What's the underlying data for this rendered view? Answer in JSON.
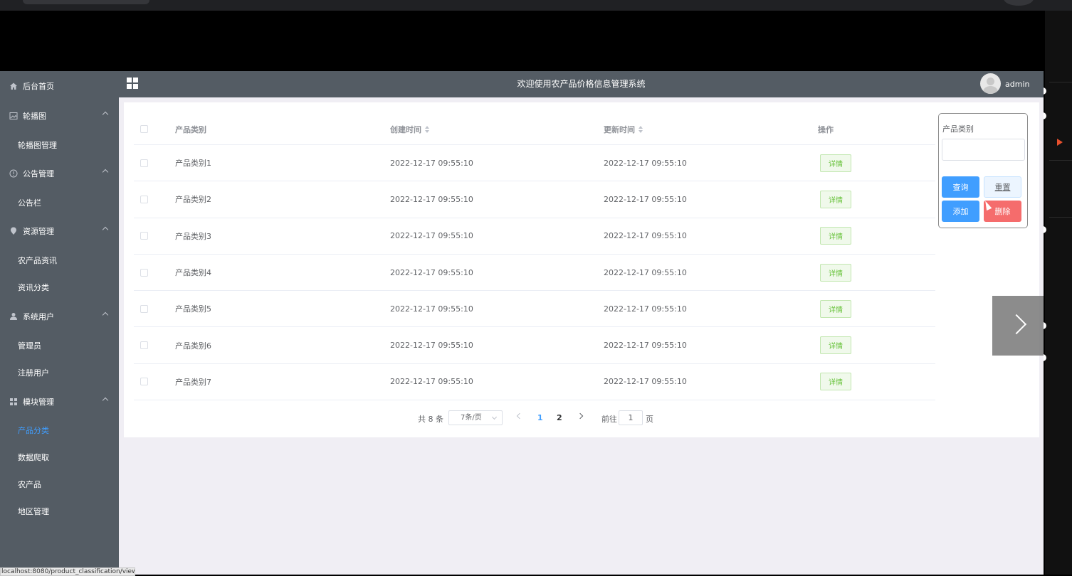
{
  "app": {
    "title": "欢迎使用农产品价格信息管理系统",
    "user": "admin"
  },
  "sidebar": {
    "items": [
      {
        "label": "后台首页",
        "icon": "home-icon"
      },
      {
        "label": "轮播图",
        "icon": "image-icon",
        "children": [
          "轮播图管理"
        ]
      },
      {
        "label": "公告管理",
        "icon": "info-circle-icon",
        "children": [
          "公告栏"
        ]
      },
      {
        "label": "资源管理",
        "icon": "location-icon",
        "children": [
          "农产品资讯",
          "资讯分类"
        ]
      },
      {
        "label": "系统用户",
        "icon": "user-icon",
        "children": [
          "管理员",
          "注册用户"
        ]
      },
      {
        "label": "模块管理",
        "icon": "grid-icon",
        "children": [
          "产品分类",
          "数据爬取",
          "农产品",
          "地区管理"
        ]
      }
    ],
    "active": "产品分类"
  },
  "table": {
    "columns": [
      "产品类别",
      "创建时间",
      "更新时间",
      "操作"
    ],
    "detail_label": "详情",
    "rows": [
      {
        "category": "产品类别1",
        "created": "2022-12-17 09:55:10",
        "updated": "2022-12-17 09:55:10"
      },
      {
        "category": "产品类别2",
        "created": "2022-12-17 09:55:10",
        "updated": "2022-12-17 09:55:10"
      },
      {
        "category": "产品类别3",
        "created": "2022-12-17 09:55:10",
        "updated": "2022-12-17 09:55:10"
      },
      {
        "category": "产品类别4",
        "created": "2022-12-17 09:55:10",
        "updated": "2022-12-17 09:55:10"
      },
      {
        "category": "产品类别5",
        "created": "2022-12-17 09:55:10",
        "updated": "2022-12-17 09:55:10"
      },
      {
        "category": "产品类别6",
        "created": "2022-12-17 09:55:10",
        "updated": "2022-12-17 09:55:10"
      },
      {
        "category": "产品类别7",
        "created": "2022-12-17 09:55:10",
        "updated": "2022-12-17 09:55:10"
      }
    ]
  },
  "pagination": {
    "total": "共 8 条",
    "page_size": "7条/页",
    "pages": [
      "1",
      "2"
    ],
    "goto_label": "前往",
    "goto_value": "1",
    "page_suffix": "页"
  },
  "search": {
    "label": "产品类别",
    "value": "",
    "query": "查询",
    "reset": "重置",
    "add": "添加",
    "delete": "删除"
  },
  "statusbar": {
    "url": "localhost:8080/product_classification/view"
  },
  "colors": {
    "sidebar": "#545c64",
    "primary": "#409eff",
    "danger": "#f56c6c",
    "success": "#67c23a"
  }
}
